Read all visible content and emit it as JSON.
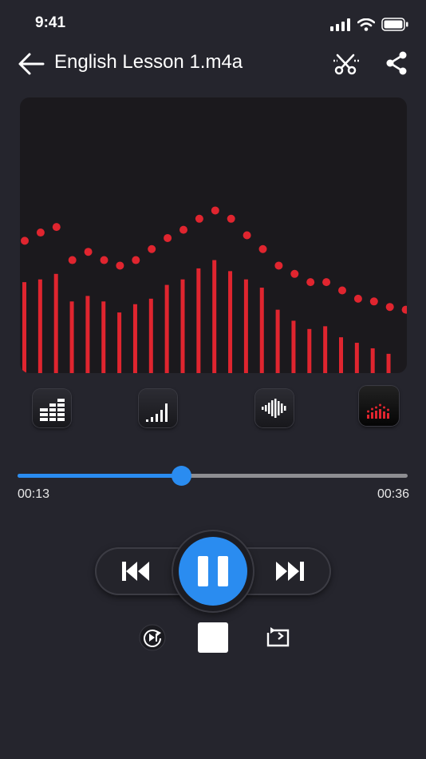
{
  "status": {
    "time": "9:41"
  },
  "header": {
    "title": "English Lesson 1.m4a"
  },
  "visualizer": {
    "bar_color": "#e0252f",
    "bar_levels": [
      0.33,
      0.34,
      0.36,
      0.26,
      0.28,
      0.26,
      0.22,
      0.25,
      0.27,
      0.32,
      0.34,
      0.38,
      0.41,
      0.37,
      0.34,
      0.31,
      0.23,
      0.19,
      0.16,
      0.17,
      0.13,
      0.11,
      0.09,
      0.07
    ],
    "peak_levels": [
      0.48,
      0.51,
      0.53,
      0.41,
      0.44,
      0.41,
      0.39,
      0.41,
      0.45,
      0.49,
      0.52,
      0.56,
      0.59,
      0.56,
      0.5,
      0.45,
      0.39,
      0.36,
      0.33,
      0.33,
      0.3,
      0.27,
      0.26,
      0.24,
      0.23
    ],
    "modes": [
      "equalizer-bars-icon",
      "signal-bars-icon",
      "waveform-icon",
      "spectrum-dots-icon"
    ],
    "active_mode": 3
  },
  "player": {
    "current_time": "00:13",
    "total_time": "00:36",
    "progress": 0.42,
    "accent": "#2a8cf0"
  }
}
